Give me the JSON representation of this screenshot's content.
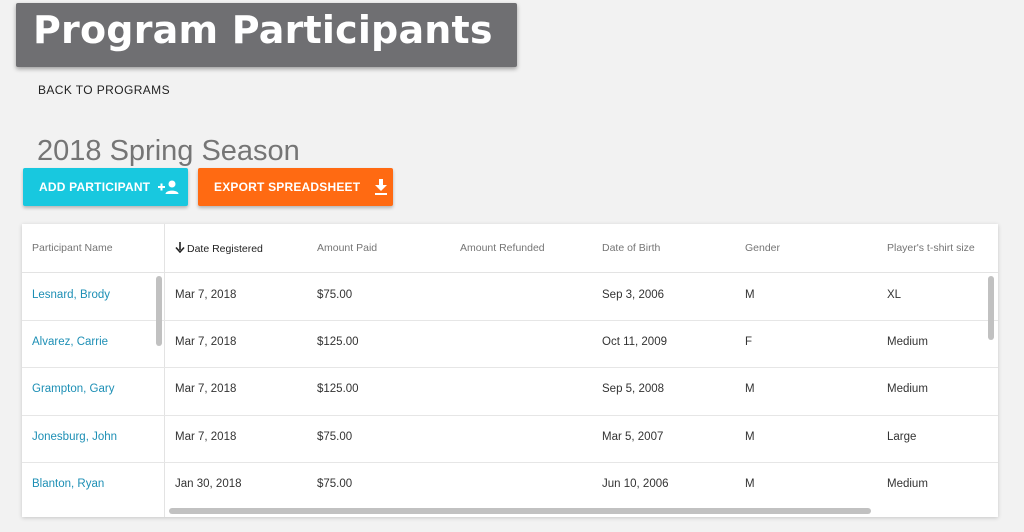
{
  "banner": {
    "title": "Program Participants"
  },
  "nav": {
    "back_label": "BACK TO PROGRAMS"
  },
  "season": {
    "title": "2018 Spring Season"
  },
  "actions": {
    "add_label": "ADD PARTICIPANT",
    "add_icon": "add-person-icon",
    "add_color": "#18c8df",
    "export_label": "EXPORT SPREADSHEET",
    "export_icon": "download-icon",
    "export_color": "#ff6a12"
  },
  "table": {
    "columns": [
      "Participant Name",
      "Date Registered",
      "Amount Paid",
      "Amount Refunded",
      "Date of Birth",
      "Gender",
      "Player's t-shirt size"
    ],
    "sort": {
      "column": "Date Registered",
      "direction": "descending",
      "icon": "arrow-down-icon"
    },
    "rows": [
      {
        "name": "Lesnard, Brody",
        "registered": "Mar 7, 2018",
        "paid": "$75.00",
        "refunded": "",
        "dob": "Sep 3, 2006",
        "gender": "M",
        "shirt": "XL"
      },
      {
        "name": "Alvarez, Carrie",
        "registered": "Mar 7, 2018",
        "paid": "$125.00",
        "refunded": "",
        "dob": "Oct 11, 2009",
        "gender": "F",
        "shirt": "Medium"
      },
      {
        "name": "Grampton, Gary",
        "registered": "Mar 7, 2018",
        "paid": "$125.00",
        "refunded": "",
        "dob": "Sep 5, 2008",
        "gender": "M",
        "shirt": "Medium"
      },
      {
        "name": "Jonesburg, John",
        "registered": "Mar 7, 2018",
        "paid": "$75.00",
        "refunded": "",
        "dob": "Mar 5, 2007",
        "gender": "M",
        "shirt": "Large"
      },
      {
        "name": "Blanton, Ryan",
        "registered": "Jan 30, 2018",
        "paid": "$75.00",
        "refunded": "",
        "dob": "Jun 10, 2006",
        "gender": "M",
        "shirt": "Medium"
      }
    ]
  },
  "colors": {
    "link": "#1d8fb5",
    "banner": "#6f6f72",
    "background": "#f2f2f2"
  }
}
